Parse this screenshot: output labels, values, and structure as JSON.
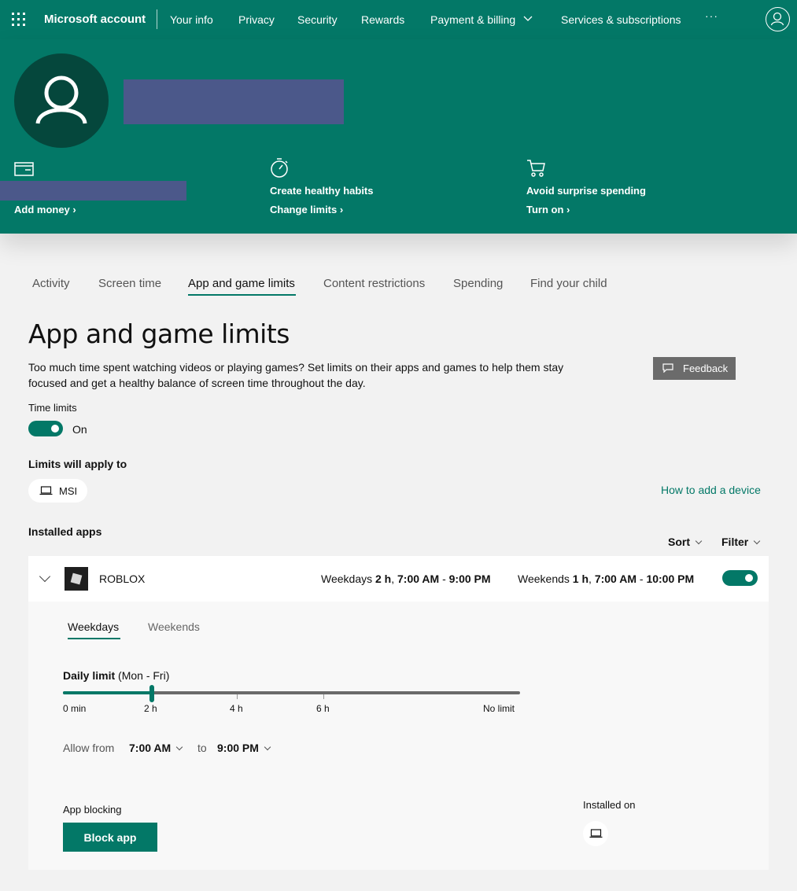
{
  "nav": {
    "brand": "Microsoft account",
    "items": [
      "Your info",
      "Privacy",
      "Security",
      "Rewards",
      "Payment & billing",
      "Services & subscriptions"
    ],
    "more": "···"
  },
  "hero": {
    "cards": [
      {
        "title": "",
        "link": "Add money",
        "icon": "wallet-icon"
      },
      {
        "title": "Create healthy habits",
        "link": "Change limits",
        "icon": "timer-icon"
      },
      {
        "title": "Avoid surprise spending",
        "link": "Turn on",
        "icon": "cart-icon"
      }
    ]
  },
  "tabs": [
    "Activity",
    "Screen time",
    "App and game limits",
    "Content restrictions",
    "Spending",
    "Find your child"
  ],
  "active_tab": "App and game limits",
  "page": {
    "title": "App and game limits",
    "description": "Too much time spent watching videos or playing games? Set limits on their apps and games to help them stay focused and get a healthy balance of screen time throughout the day.",
    "feedback": "Feedback",
    "time_limits_label": "Time limits",
    "time_limits_state": "On",
    "limits_apply_to": "Limits will apply to",
    "device": "MSI",
    "add_device_link": "How to add a device",
    "installed_apps": "Installed apps",
    "sort": "Sort",
    "filter": "Filter"
  },
  "app": {
    "name": "ROBLOX",
    "weekdays_label": "Weekdays",
    "weekdays_hours": "2 h",
    "weekdays_from": "7:00 AM",
    "weekdays_to": "9:00 PM",
    "weekends_label": "Weekends",
    "weekends_hours": "1 h",
    "weekends_from": "7:00 AM",
    "weekends_to": "10:00 PM",
    "enabled": true,
    "subtabs": [
      "Weekdays",
      "Weekends"
    ],
    "daily_limit_label": "Daily limit",
    "daily_limit_range": "(Mon - Fri)",
    "slider_value_fraction": 0.194,
    "ticks": [
      "0 min",
      "2 h",
      "4 h",
      "6 h",
      "No limit"
    ],
    "allow_from_label": "Allow from",
    "allow_from": "7:00 AM",
    "to_label": "to",
    "allow_to": "9:00 PM",
    "app_blocking_label": "App blocking",
    "block_button": "Block app",
    "installed_on_label": "Installed on"
  },
  "colors": {
    "brand_green": "#037867",
    "dark_green": "#05473c",
    "redaction": "#4b588a"
  }
}
